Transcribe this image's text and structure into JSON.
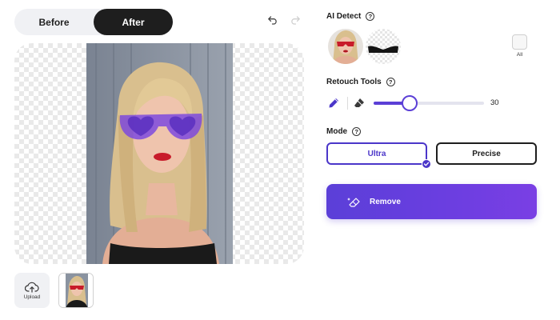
{
  "toggle": {
    "before_label": "Before",
    "after_label": "After",
    "selected": "After"
  },
  "ai_detect": {
    "title": "AI Detect",
    "all_label": "All"
  },
  "retouch": {
    "title": "Retouch Tools",
    "brush_size": 30
  },
  "mode": {
    "title": "Mode",
    "ultra_label": "Ultra",
    "precise_label": "Precise",
    "selected": "Ultra"
  },
  "actions": {
    "remove_label": "Remove",
    "upload_label": "Upload"
  },
  "colors": {
    "accent": "#5b3fd6",
    "remove_gradient_start": "#5b3fd8",
    "remove_gradient_end": "#7a3fe4",
    "dark": "#1e1e1e"
  },
  "icons": [
    "undo-icon",
    "redo-icon",
    "help-icon",
    "brush-icon",
    "eraser-icon",
    "upload-cloud-icon",
    "check-icon",
    "remove-sparkle-icon"
  ]
}
